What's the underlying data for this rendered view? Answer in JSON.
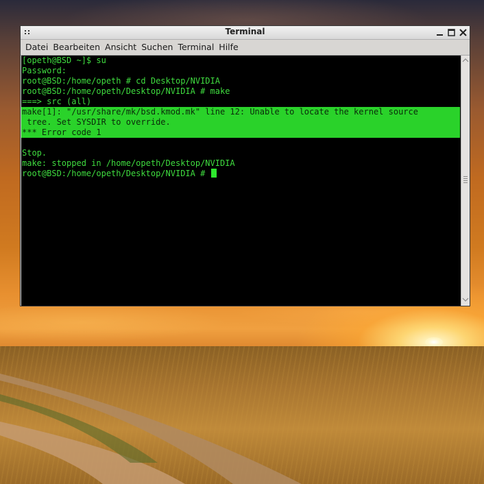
{
  "window": {
    "title": "Terminal"
  },
  "menu": {
    "items": [
      {
        "label": "Datei"
      },
      {
        "label": "Bearbeiten"
      },
      {
        "label": "Ansicht"
      },
      {
        "label": "Suchen"
      },
      {
        "label": "Terminal"
      },
      {
        "label": "Hilfe"
      }
    ]
  },
  "terminal": {
    "lines": [
      {
        "text": "[opeth@BSD ~]$ su",
        "highlight": false
      },
      {
        "text": "Password:",
        "highlight": false
      },
      {
        "text": "root@BSD:/home/opeth # cd Desktop/NVIDIA",
        "highlight": false
      },
      {
        "text": "root@BSD:/home/opeth/Desktop/NVIDIA # make",
        "highlight": false
      },
      {
        "text": "===> src (all)",
        "highlight": false
      },
      {
        "text": "make[1]: \"/usr/share/mk/bsd.kmod.mk\" line 12: Unable to locate the kernel source",
        "highlight": true
      },
      {
        "text": " tree. Set SYSDIR to override.",
        "highlight": true
      },
      {
        "text": "*** Error code 1",
        "highlight": true
      },
      {
        "text": "",
        "highlight": false
      },
      {
        "text": "Stop.",
        "highlight": false
      },
      {
        "text": "make: stopped in /home/opeth/Desktop/NVIDIA",
        "highlight": false
      },
      {
        "text": "root@BSD:/home/opeth/Desktop/NVIDIA # ",
        "highlight": false,
        "cursor": true
      }
    ],
    "text_color": "#3fdc3f",
    "highlight_color": "#2ad22a",
    "background_color": "#000000"
  },
  "icons": {
    "window_menu": "window-menu-icon",
    "minimize": "minimize-icon",
    "maximize": "maximize-icon",
    "close": "close-icon"
  }
}
